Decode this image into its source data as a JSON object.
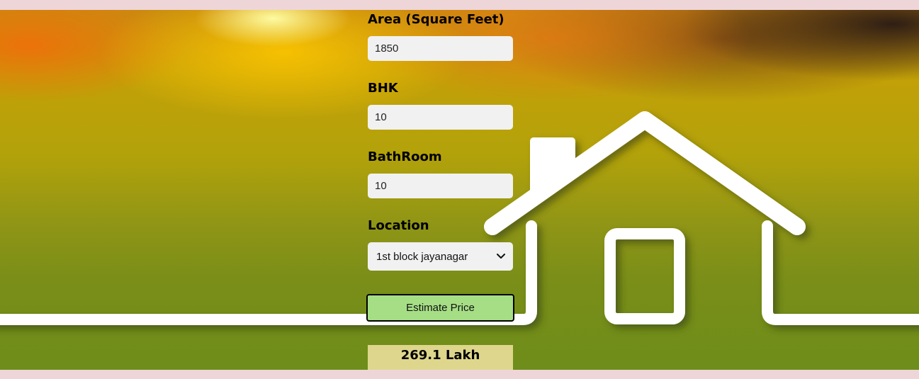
{
  "form": {
    "area": {
      "label": "Area (Square Feet)",
      "value": "1850"
    },
    "bhk": {
      "label": "BHK",
      "value": "10"
    },
    "bathroom": {
      "label": "BathRoom",
      "value": "10"
    },
    "location": {
      "label": "Location",
      "selected": "1st block jayanagar"
    },
    "submit_label": "Estimate Price"
  },
  "result": {
    "text": "269.1 Lakh"
  },
  "colors": {
    "page_background": "#eed6d8",
    "input_background": "#f1f1f1",
    "button_background": "#a6de86",
    "result_background": "#ded68c"
  },
  "decor": {
    "background_image": "house-outline-icon"
  }
}
